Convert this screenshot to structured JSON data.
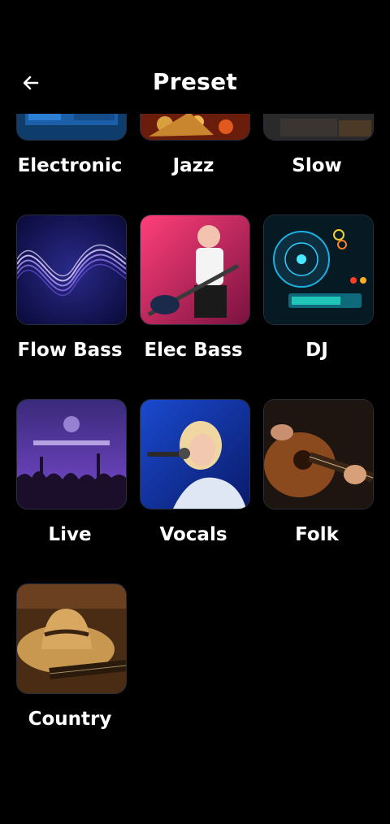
{
  "header": {
    "title": "Preset",
    "back_icon": "arrow-left-icon"
  },
  "presets": [
    {
      "label": "Electronic"
    },
    {
      "label": "Jazz"
    },
    {
      "label": "Slow"
    },
    {
      "label": "Flow Bass"
    },
    {
      "label": "Elec Bass"
    },
    {
      "label": "DJ"
    },
    {
      "label": "Live"
    },
    {
      "label": "Vocals"
    },
    {
      "label": "Folk"
    },
    {
      "label": "Country"
    }
  ]
}
